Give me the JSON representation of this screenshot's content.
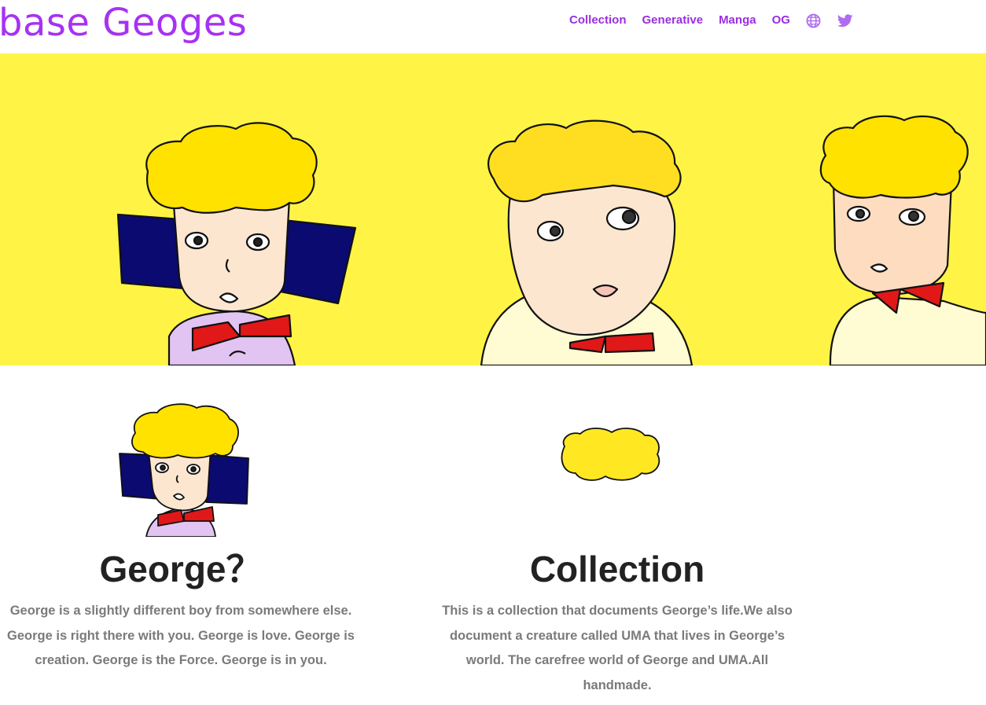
{
  "header": {
    "logo": "base Geoges",
    "nav": [
      "Collection",
      "Generative",
      "Manga",
      "OG"
    ],
    "icons": [
      "globe-icon",
      "twitter-icon"
    ]
  },
  "colors": {
    "brand": "#a632f2",
    "hero_bg": "#fff346",
    "heading": "#222222",
    "body_text": "#7a7a7a"
  },
  "sections": {
    "george": {
      "title": "George？",
      "text": "George is a slightly different boy from somewhere else. George is right there with you. George is love. George is creation. George is the Force. George is in you."
    },
    "collection": {
      "title": "Collection",
      "text": "This is a collection that documents George’s life.We also document a creature called UMA that lives in George’s world. The carefree world of George and UMA.All handmade."
    }
  }
}
